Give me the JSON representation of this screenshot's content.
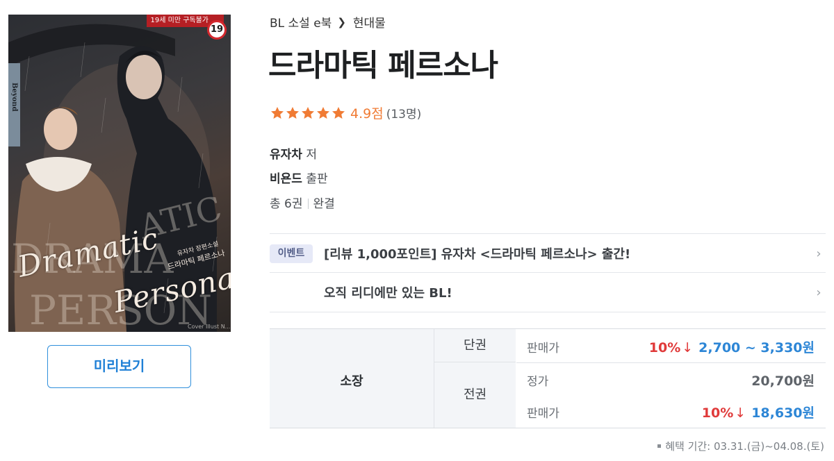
{
  "cover": {
    "age_strip": "19세 미만 구독불가",
    "age_badge": "19",
    "imprint": "Beyond",
    "script_title_1": "Dramatic",
    "script_title_2": "Persona",
    "ghost_1": "DRAMA",
    "ghost_2": "PERSON",
    "ghost_3": "ATIC",
    "subtitle_small": "유자차 장편소설",
    "subtitle": "드라마틱 페르소나",
    "credit": "Cover Illust N..."
  },
  "preview_button": "미리보기",
  "breadcrumb": {
    "category": "BL 소설 e북",
    "subcategory": "현대물"
  },
  "title": "드라마틱 페르소나",
  "rating": {
    "stars": 5,
    "score": "4.9점",
    "count": "(13명)",
    "color": "#f07b34"
  },
  "author": {
    "name": "유자차",
    "suffix": "저"
  },
  "publisher": {
    "name": "비욘드",
    "suffix": "출판"
  },
  "volumes": {
    "total": "총 6권",
    "status": "완결"
  },
  "events": [
    {
      "badge": "이벤트",
      "text": "[리뷰 1,000포인트] 유자차 <드라마틱 페르소나> 출간!"
    },
    {
      "badge": "",
      "text": "오직 리디에만 있는 BL!"
    }
  ],
  "price": {
    "own_label": "소장",
    "single": {
      "label": "단권",
      "sale_label": "판매가",
      "discount": "10%",
      "range": "2,700 ~ 3,330원"
    },
    "full": {
      "label": "전권",
      "regular_label": "정가",
      "regular": "20,700원",
      "sale_label": "판매가",
      "discount": "10%",
      "sale": "18,630원"
    }
  },
  "benefit_period": "혜택 기간: 03.31.(금)~04.08.(토)"
}
